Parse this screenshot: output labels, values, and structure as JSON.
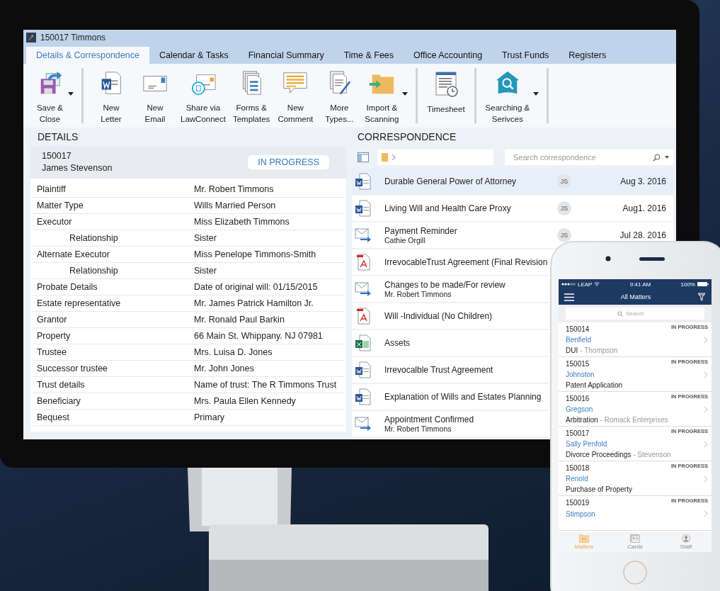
{
  "monitor_window": {
    "title": "150017 Timmons",
    "tabs": [
      {
        "label": "Details & Correspondence",
        "selected": true
      },
      {
        "label": "Calendar & Tasks",
        "selected": false
      },
      {
        "label": "Financial Summary",
        "selected": false
      },
      {
        "label": "Time & Fees",
        "selected": false
      },
      {
        "label": "Office Accounting",
        "selected": false
      },
      {
        "label": "Trust Funds",
        "selected": false
      },
      {
        "label": "Registers",
        "selected": false
      }
    ],
    "ribbon_groups": [
      [
        {
          "kind": "save",
          "lines": [
            "Save &",
            "Close"
          ],
          "dropdown": true
        }
      ],
      [
        {
          "kind": "letter",
          "lines": [
            "New",
            "Letter"
          ],
          "dropdown": false
        },
        {
          "kind": "email",
          "lines": [
            "New",
            "Email"
          ],
          "dropdown": false
        },
        {
          "kind": "share",
          "lines": [
            "Share via",
            "LawConnect"
          ],
          "dropdown": false
        },
        {
          "kind": "forms",
          "lines": [
            "Forms &",
            "Templates"
          ],
          "dropdown": false
        },
        {
          "kind": "comment",
          "lines": [
            "New",
            "Comment"
          ],
          "dropdown": false
        },
        {
          "kind": "more",
          "lines": [
            "More",
            "Types..."
          ],
          "dropdown": false
        },
        {
          "kind": "import",
          "lines": [
            "Import &",
            "Scanning"
          ],
          "dropdown": true
        }
      ],
      [
        {
          "kind": "timesheet",
          "lines": [
            "Timesheet"
          ],
          "dropdown": false
        }
      ],
      [
        {
          "kind": "searching",
          "lines": [
            "Searching &",
            "Serivces"
          ],
          "dropdown": true
        }
      ]
    ],
    "details": {
      "heading": "DETAILS",
      "matter_number": "150017",
      "client": "James Stevenson",
      "status": "IN PROGRESS",
      "rows": [
        {
          "label": "Plaintiff",
          "value": "Mr. Robert Timmons",
          "indent": false
        },
        {
          "label": "Matter Type",
          "value": "Wills Married Person",
          "indent": false
        },
        {
          "label": "Executor",
          "value": "Miss Elizabeth Timmons",
          "indent": false
        },
        {
          "label": "Relationship",
          "value": "Sister",
          "indent": true
        },
        {
          "label": "Alternate Executor",
          "value": "Miss Penelope Timmons-Smith",
          "indent": false
        },
        {
          "label": "Relationship",
          "value": "Sister",
          "indent": true
        },
        {
          "label": "Probate Details",
          "value": "Date of original will: 01/15/2015",
          "indent": false
        },
        {
          "label": "Estate representative",
          "value": "Mr. James Patrick Hamilton Jr.",
          "indent": false
        },
        {
          "label": "Grantor",
          "value": "Mr. Ronald Paul Barkin",
          "indent": false
        },
        {
          "label": "Property",
          "value": "66 Main St. Whippany. NJ 07981",
          "indent": false
        },
        {
          "label": "Trustee",
          "value": "Mrs. Luisa D. Jones",
          "indent": false
        },
        {
          "label": "Successor trustee",
          "value": "Mr. John Jones",
          "indent": false
        },
        {
          "label": "Trust details",
          "value": "Name of trust: The R Timmons Trust",
          "indent": false
        },
        {
          "label": "Beneficiary",
          "value": "Mrs. Paula Ellen Kennedy",
          "indent": false
        },
        {
          "label": "Bequest",
          "value": "Primary",
          "indent": false
        }
      ]
    },
    "correspondence": {
      "heading": "CORRESPONDENCE",
      "search": {
        "placeholder": "Search correspondence"
      },
      "items": [
        {
          "kind": "word",
          "title": "Durable General Power of Attorney",
          "initials": "JS",
          "date": "Aug 3. 2016",
          "selected": true
        },
        {
          "kind": "word",
          "title": "Living Will and Health Care Proxy",
          "initials": "JS",
          "date": "Aug1. 2016",
          "selected": false
        },
        {
          "kind": "email",
          "title": "Payment Reminder",
          "subtitle": "Cathie Orgill",
          "initials": "JS",
          "date": "Jul 28. 2016",
          "selected": false
        },
        {
          "kind": "pdf",
          "title": "IrrevocableTrust Agreement (Final Revision",
          "selected": false
        },
        {
          "kind": "email",
          "title": "Changes to be made/For review",
          "subtitle": "Mr. Robert Timmons",
          "selected": false
        },
        {
          "kind": "pdf",
          "title": "Will -Individual (No Children)",
          "selected": false
        },
        {
          "kind": "excel",
          "title": "Assets",
          "selected": false
        },
        {
          "kind": "word",
          "title": "Irrevocalble Trust Agreement",
          "selected": false
        },
        {
          "kind": "word",
          "title": "Explanation of Wills and Estates Planning",
          "selected": false
        },
        {
          "kind": "email",
          "title": "Appointment Confirmed",
          "subtitle": "Mr. Robert Timmons",
          "selected": false
        }
      ]
    }
  },
  "phone": {
    "status_bar": {
      "carrier": "LEAP",
      "time": "9:41 AM",
      "battery": "100%"
    },
    "title": "All Matters",
    "search": {
      "placeholder": "Search"
    },
    "matters": [
      {
        "number": "150014",
        "status": "IN PROGRESS",
        "name": "Benfield",
        "type": "DUI",
        "client": "- Thompson"
      },
      {
        "number": "150015",
        "status": "IN PROGRESS",
        "name": "Johnston",
        "type": "Patent Application"
      },
      {
        "number": "150016",
        "status": "IN PROGRESS",
        "name": "Gregson",
        "type": "Arbitration",
        "client": "- Romack Enterprises"
      },
      {
        "number": "150017",
        "status": "IN PROGRESS",
        "name": "Sally Penfold",
        "type": "Divorce Proceedings",
        "client": "- Stevenson"
      },
      {
        "number": "150018",
        "status": "IN PROGRESS",
        "name": "Renold",
        "type": "Purchase of Property"
      },
      {
        "number": "150019",
        "status": "IN PROGRESS",
        "name": "Stimpson"
      }
    ],
    "tab_bar": [
      {
        "kind": "matters",
        "label": "Matters",
        "selected": true
      },
      {
        "kind": "cards",
        "label": "Cards",
        "selected": false
      },
      {
        "kind": "staff",
        "label": "Staff",
        "selected": false
      }
    ]
  }
}
